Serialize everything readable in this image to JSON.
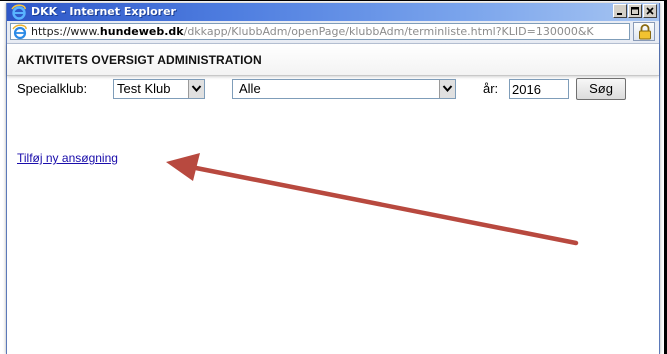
{
  "window": {
    "title": "DKK - Internet Explorer"
  },
  "address": {
    "scheme": "https://www.",
    "host": "hundeweb.dk",
    "path": "/dkkapp/KlubbAdm/openPage/klubbAdm/terminliste.html?KLID=130000&K"
  },
  "page": {
    "title": "AKTIVITETS OVERSIGT ADMINISTRATION"
  },
  "filters": {
    "club_label": "Specialklub:",
    "club_value": "Test Klub",
    "type_value": "Alle",
    "year_label": "år:",
    "year_value": "2016",
    "search_button": "Søg"
  },
  "actions": {
    "add_application": "Tilføj ny ansøgning"
  },
  "colors": {
    "annotation_arrow": "#b8493f",
    "link": "#1a0dab"
  },
  "icons": {
    "app": "ie-logo-icon",
    "url": "ie-logo-icon",
    "security": "padlock-icon"
  }
}
